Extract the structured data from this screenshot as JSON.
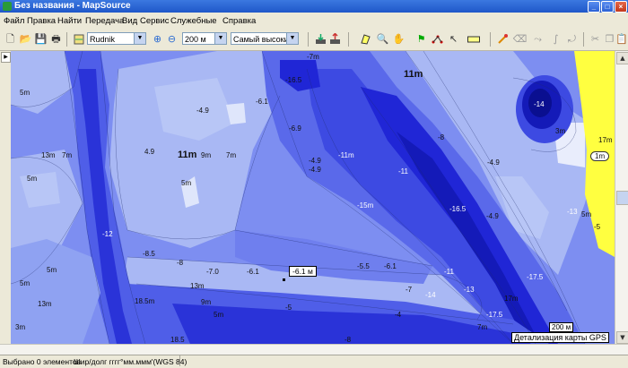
{
  "window": {
    "title": "Без названия - MapSource",
    "min": "_",
    "max": "□",
    "close": "×"
  },
  "menu": [
    "Файл",
    "Правка",
    "Найти",
    "Передача",
    "Вид",
    "Сервис",
    "Служебные",
    "Справка"
  ],
  "toolbar": {
    "map_product": "Rudnik",
    "scale": "200 м",
    "detail": "Самый высокий"
  },
  "icons": {
    "new": "🗋",
    "open": "📂",
    "save": "💾",
    "print": "🖶",
    "zoom_in": "⊕",
    "zoom_out": "⊖",
    "zoom_tool": "🔍",
    "hand": "✋",
    "waypoint": "⚑",
    "route": "⋰",
    "select": "↖",
    "distance": "📏",
    "cut": "✂",
    "copy": "❐",
    "paste": "📋"
  },
  "map": {
    "cursor_depth": "-6.1 м",
    "scale_bar": "200 м",
    "detail_label": "Детализация карты GPS",
    "labels": [
      {
        "t": "-16.5"
      },
      {
        "t": "-7m"
      },
      {
        "t": "11m"
      },
      {
        "t": "-14"
      },
      {
        "t": "3m"
      },
      {
        "t": "17m"
      },
      {
        "t": "1m"
      },
      {
        "t": "-6.1"
      },
      {
        "t": "-4.9"
      },
      {
        "t": "-6.9"
      },
      {
        "t": "-4.9"
      },
      {
        "t": "-8"
      },
      {
        "t": "5m"
      },
      {
        "t": "5m"
      },
      {
        "t": "13m"
      },
      {
        "t": "7m"
      },
      {
        "t": "-11m"
      },
      {
        "t": "-11"
      },
      {
        "t": "-4.9"
      },
      {
        "t": "4.9"
      },
      {
        "t": "11m"
      },
      {
        "t": "9m"
      },
      {
        "t": "7m"
      },
      {
        "t": "5m"
      },
      {
        "t": "-4.9"
      },
      {
        "t": "-15m"
      },
      {
        "t": "-16.5"
      },
      {
        "t": "-17.5"
      },
      {
        "t": "-4.9"
      },
      {
        "t": "-13"
      },
      {
        "t": "-12"
      },
      {
        "t": "-8.5"
      },
      {
        "t": "-8"
      },
      {
        "t": "-7.0"
      },
      {
        "t": "-6.1"
      },
      {
        "t": "-5.5"
      },
      {
        "t": "-6.1"
      },
      {
        "t": "-7"
      },
      {
        "t": "-11"
      },
      {
        "t": "-13"
      },
      {
        "t": "-17.5"
      },
      {
        "t": "-14"
      },
      {
        "t": "17m"
      },
      {
        "t": "13m"
      },
      {
        "t": "9m"
      },
      {
        "t": "5m"
      },
      {
        "t": "-5"
      },
      {
        "t": "-4"
      },
      {
        "t": "13m"
      },
      {
        "t": "18.5m"
      },
      {
        "t": "18.5"
      },
      {
        "t": "-8"
      },
      {
        "t": "5m"
      },
      {
        "t": "5m"
      },
      {
        "t": "3m"
      },
      {
        "t": "7m"
      },
      {
        "t": "5m"
      },
      {
        "t": "-5"
      }
    ]
  },
  "status": {
    "selected": "Выбрано 0 элементов",
    "coords": "Шир/долг гггг°мм.ммм'(WGS 84)"
  },
  "colors": {
    "deep": "#1a1fd8",
    "mid": "#4f5ee8",
    "shallow": "#8fa2f2",
    "land": "#ffff40",
    "very_shallow": "#b8c6f6"
  }
}
